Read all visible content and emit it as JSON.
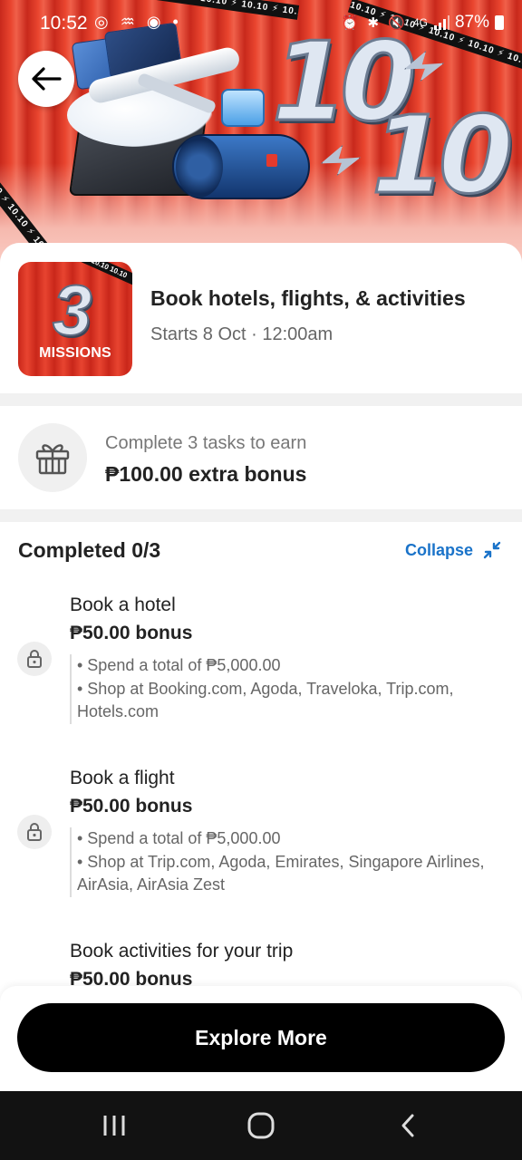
{
  "status_bar": {
    "time": "10:52",
    "glyphs": "◎ ♒ ◉ •",
    "network": "4G",
    "battery": "87%"
  },
  "hero": {
    "tape_text": "10.10 ⚡ 10.10 ⚡ 10.10 ⚡ 10.10 ⚡ 10.10 ⚡ 10.10 ⚡ 10.10",
    "big_number_top": "10",
    "big_number_bottom": "10"
  },
  "campaign": {
    "thumb_number": "3",
    "thumb_label": "MISSIONS",
    "thumb_tape": "10.10 10.10 10.10",
    "title": "Book hotels, flights, & activities",
    "subtitle": "Starts 8 Oct · 12:00am"
  },
  "reward": {
    "text": "Complete 3 tasks to earn",
    "amount": "₱100.00 extra bonus"
  },
  "tasks": {
    "title": "Completed 0/3",
    "collapse_label": "Collapse",
    "items": [
      {
        "name": "Book a hotel",
        "bonus": "₱50.00 bonus",
        "spend": "• Spend a total of ₱5,000.00",
        "shops": "• Shop at Booking.com, Agoda, Traveloka, Trip.com, Hotels.com"
      },
      {
        "name": "Book a flight",
        "bonus": "₱50.00 bonus",
        "spend": "• Spend a total of ₱5,000.00",
        "shops": "• Shop at Trip.com, Agoda, Emirates, Singapore Airlines, AirAsia, AirAsia Zest"
      },
      {
        "name": "Book activities for your trip",
        "bonus": "₱50.00 bonus"
      }
    ]
  },
  "footer": {
    "explore_label": "Explore More"
  },
  "colors": {
    "accent_link": "#1a73c9",
    "hero_red": "#e9452f",
    "button_black": "#000000"
  }
}
